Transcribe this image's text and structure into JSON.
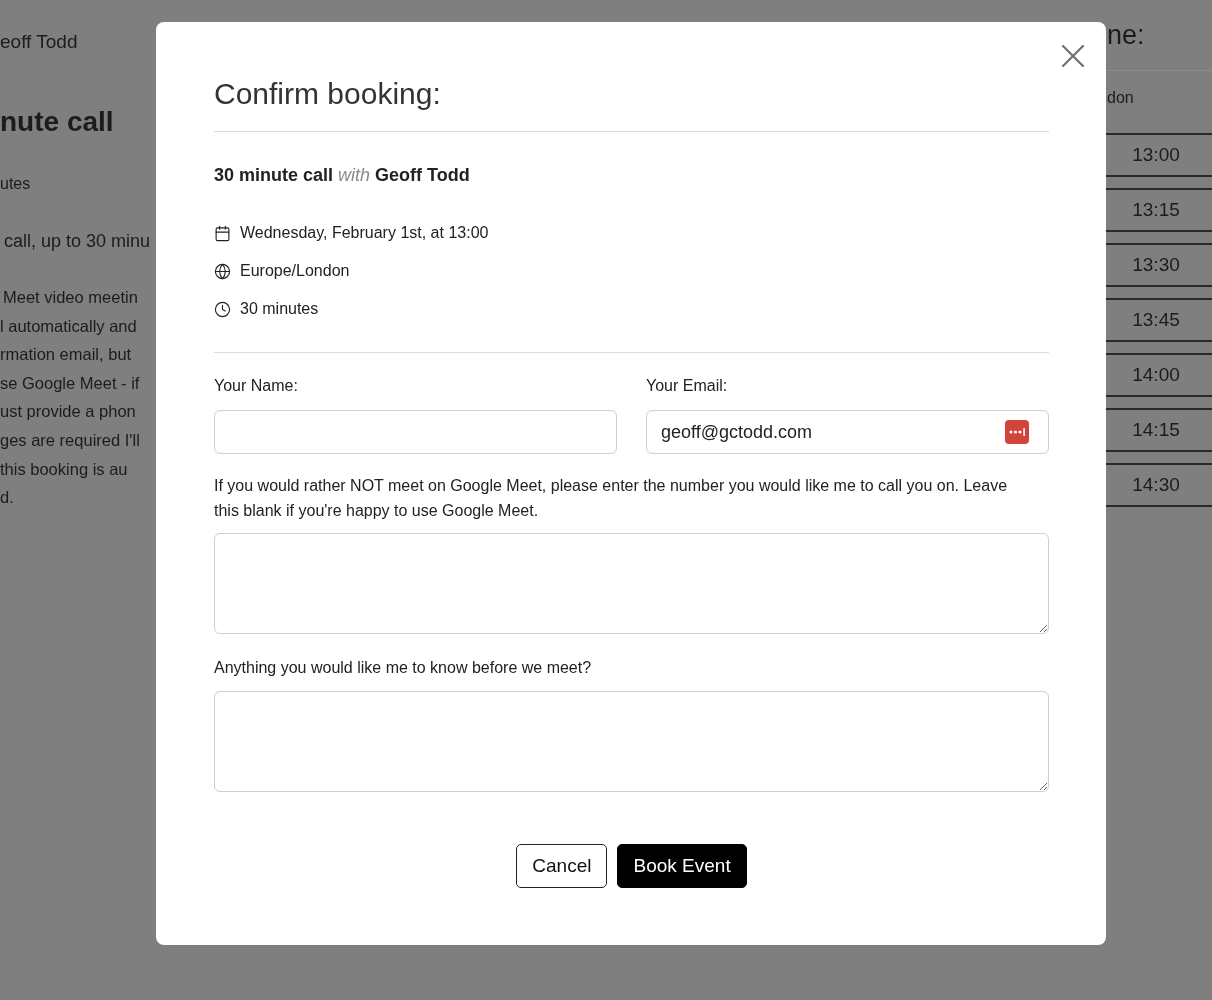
{
  "background_page": {
    "left_column": {
      "host": "eoff Todd",
      "title": "nute call",
      "duration": "utes",
      "summary": "call, up to 30 minu",
      "description_lines": [
        "Meet video meetin",
        "l automatically and",
        "rmation email, but",
        "se Google Meet - if",
        "ust provide a phon",
        "ges are required I'll",
        "this booking is au",
        "d."
      ]
    },
    "right_column": {
      "heading": "ne:",
      "timezone": "don",
      "time_slots": [
        "13:00",
        "13:15",
        "13:30",
        "13:45",
        "14:00",
        "14:15",
        "14:30"
      ]
    }
  },
  "dialog": {
    "title": "Confirm booking:",
    "event": "**30 minute call** *with* **Geoff Todd**",
    "details": [
      {
        "kind": "date",
        "text": "Wednesday, February 1st, at 13:00"
      },
      {
        "kind": "timezone",
        "text": "Europe/London"
      },
      {
        "kind": "duration",
        "text": "30 minutes"
      }
    ],
    "name_field": {
      "label": "Your Name:"
    },
    "email_field": {
      "label": "Your Email:",
      "value": "geoff@gctodd.com"
    },
    "phone_field": {
      "label": "If you would rather NOT meet on Google Meet, please enter the number you would like me to call you on. Leave this blank if you're happy to use Google Meet."
    },
    "notes_field": {
      "label": "Anything you would like me to know before we meet?"
    },
    "buttons": [
      {
        "kind": "secondary",
        "label": "Cancel"
      },
      {
        "kind": "primary",
        "label": "Book Event"
      }
    ]
  }
}
